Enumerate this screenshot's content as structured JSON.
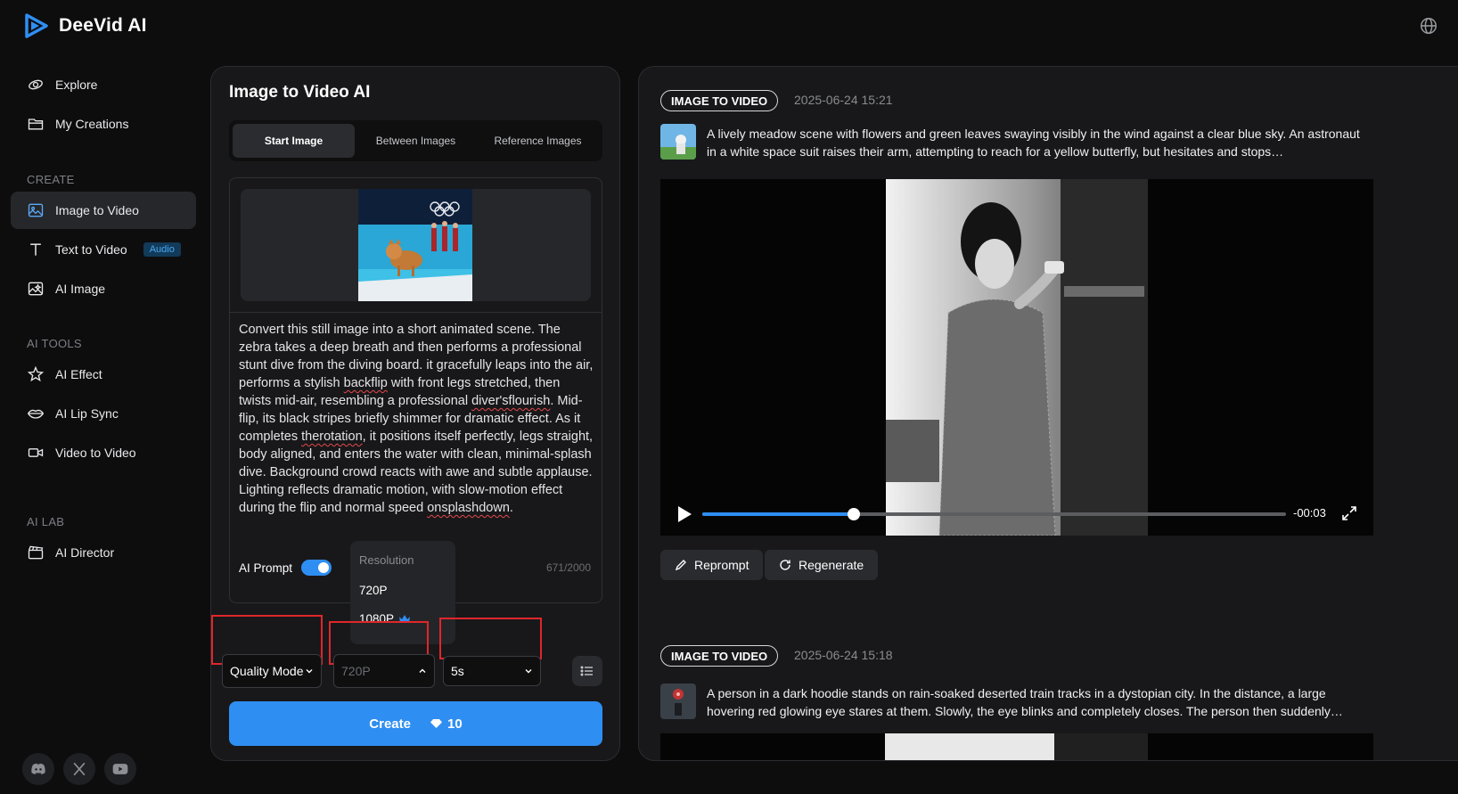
{
  "app": {
    "name": "DeeVid AI"
  },
  "sidebar": {
    "items": [
      {
        "label": "Explore",
        "icon": "explore-icon"
      },
      {
        "label": "My Creations",
        "icon": "folder-icon"
      }
    ],
    "create_heading": "CREATE",
    "create_items": [
      {
        "label": "Image to Video",
        "icon": "image-icon",
        "active": true
      },
      {
        "label": "Text to Video",
        "icon": "text-icon",
        "badge": "Audio"
      },
      {
        "label": "AI Image",
        "icon": "ai-image-icon"
      }
    ],
    "tools_heading": "AI TOOLS",
    "tools_items": [
      {
        "label": "AI Effect",
        "icon": "sparkle-icon"
      },
      {
        "label": "AI Lip Sync",
        "icon": "lips-icon"
      },
      {
        "label": "Video to Video",
        "icon": "video-camera-icon"
      }
    ],
    "lab_heading": "AI LAB",
    "lab_items": [
      {
        "label": "AI Director",
        "icon": "clapper-icon"
      }
    ],
    "social": [
      "discord-icon",
      "x-icon",
      "youtube-icon"
    ]
  },
  "creator": {
    "title": "Image to Video AI",
    "tabs": [
      {
        "label": "Start Image",
        "active": true
      },
      {
        "label": "Between Images"
      },
      {
        "label": "Reference Images"
      }
    ],
    "prompt": {
      "segments": [
        {
          "text": "Convert this still image into a short animated scene. The zebra takes a deep breath and then performs a professional stunt dive from the diving board. it gracefully leaps into the air, performs a stylish "
        },
        {
          "text": "backflip",
          "misspelled": true
        },
        {
          "text": " with front legs stretched, then twists mid-air, resembling a professional "
        },
        {
          "text": "diver'sflourish",
          "misspelled": true
        },
        {
          "text": ". Mid-flip, its black stripes briefly shimmer for dramatic effect. As it completes "
        },
        {
          "text": "therotation",
          "misspelled": true
        },
        {
          "text": ", it positions itself perfectly, legs straight, body aligned, and enters the water with clean, minimal-splash dive. Background crowd reacts with awe and subtle applause. Lighting reflects dramatic motion, with slow-motion effect during the flip and normal speed "
        },
        {
          "text": "onsplashdown",
          "misspelled": true
        },
        {
          "text": "."
        }
      ]
    },
    "ai_prompt_label": "AI Prompt",
    "ai_prompt_on": true,
    "char_count": "671/2000",
    "resolution_menu": {
      "heading": "Resolution",
      "options": [
        {
          "label": "720P"
        },
        {
          "label": "1080P",
          "premium_icon": "crown-icon"
        }
      ]
    },
    "quality_select": "Quality Mode",
    "resolution_select": "720P",
    "duration_select": "5s",
    "create_label": "Create",
    "create_cost": "10"
  },
  "history": [
    {
      "type": "IMAGE TO VIDEO",
      "timestamp": "2025-06-24 15:21",
      "description": "A lively meadow scene with flowers and green leaves swaying visibly in the wind against a clear blue sky. An astronaut in a white space suit raises their arm, attempting to reach for a yellow butterfly, but hesitates and stops…",
      "player": {
        "time_remaining": "-00:03",
        "progress": 0.26
      },
      "actions": [
        "Reprompt",
        "Regenerate"
      ]
    },
    {
      "type": "IMAGE TO VIDEO",
      "timestamp": "2025-06-24 15:18",
      "description": "A person in a dark hoodie stands on rain-soaked deserted train tracks in a dystopian city. In the distance, a large hovering red glowing eye stares at them. Slowly, the eye blinks and completely closes. The person then suddenly…"
    }
  ],
  "colors": {
    "accent": "#2f8ef2",
    "highlight_frame": "#e0262a",
    "panel": "#18181a",
    "background": "#0d0d0e"
  }
}
